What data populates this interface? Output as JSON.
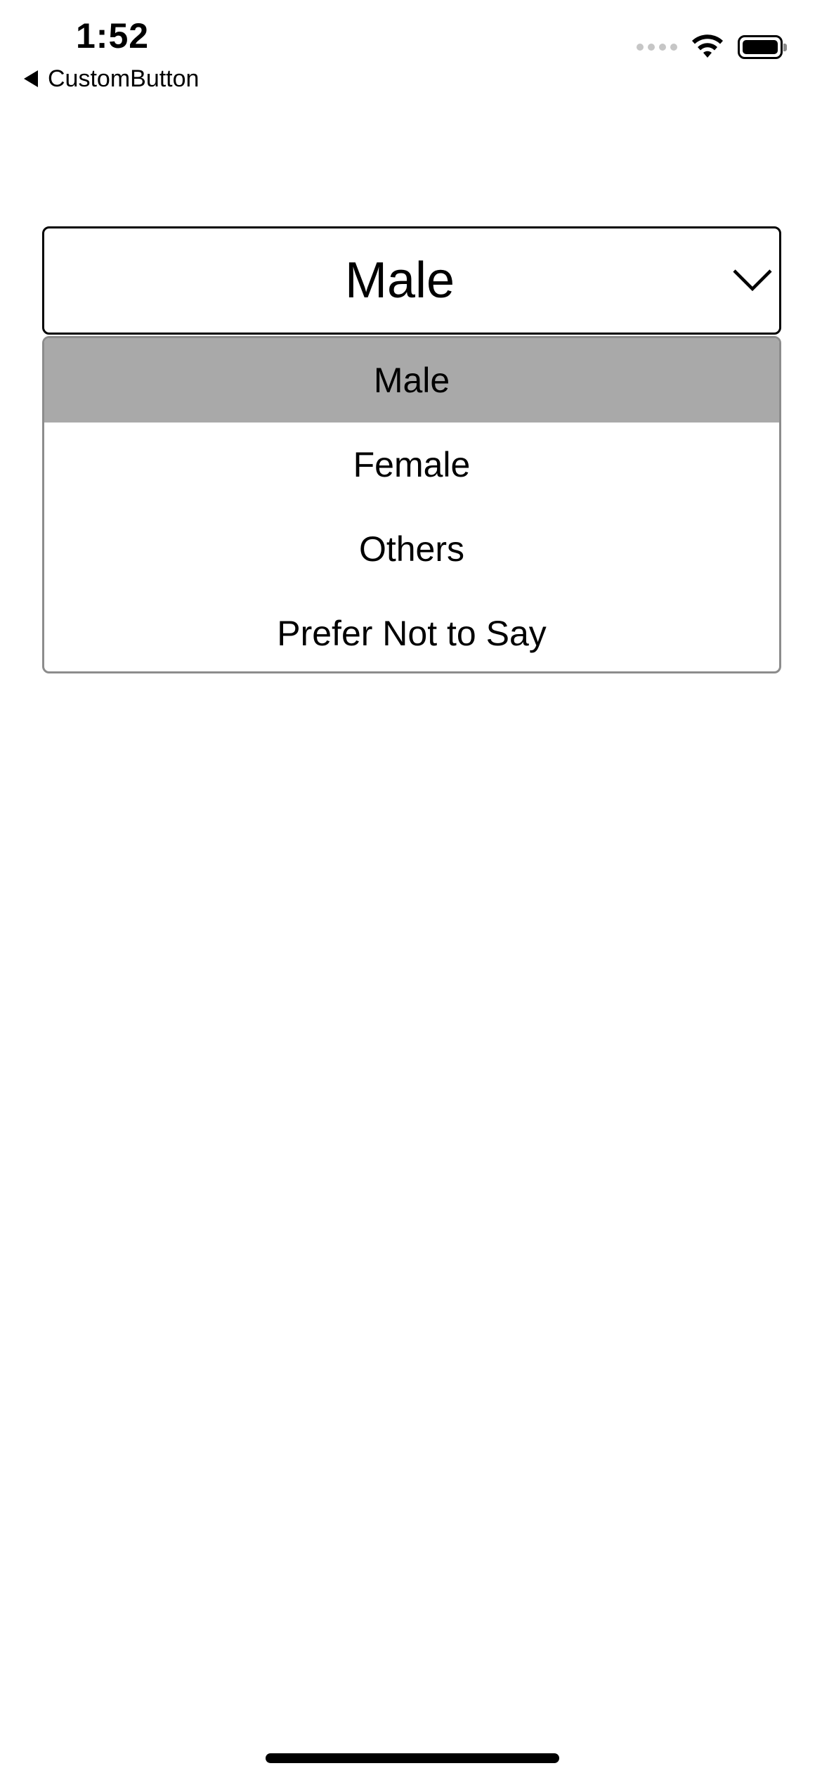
{
  "status_bar": {
    "time": "1:52",
    "back_label": "CustomButton"
  },
  "dropdown": {
    "selected_value": "Male",
    "options": [
      {
        "label": "Male",
        "selected": true
      },
      {
        "label": "Female",
        "selected": false
      },
      {
        "label": "Others",
        "selected": false
      },
      {
        "label": "Prefer Not to Say",
        "selected": false
      }
    ]
  },
  "colors": {
    "selected_item_bg": "#a9a9a9",
    "border": "#000000",
    "list_border": "#8c8c8c"
  },
  "icons": {
    "chevron": "chevron-down-icon",
    "back": "back-arrow-icon",
    "wifi": "wifi-icon",
    "battery": "battery-icon",
    "signal": "cellular-signal-icon"
  }
}
